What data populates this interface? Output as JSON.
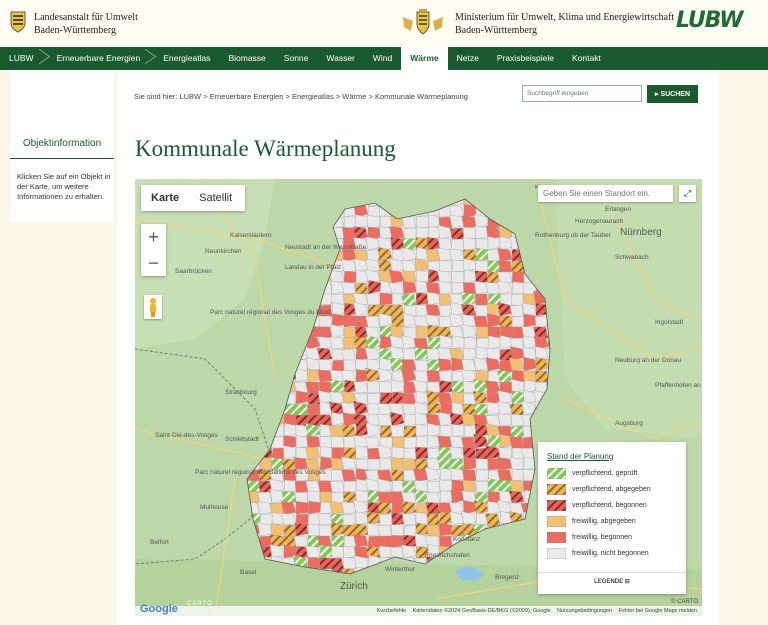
{
  "header": {
    "org_left_line1": "Landesanstalt für Umwelt",
    "org_left_line2": "Baden-Württemberg",
    "org_right_line1": "Ministerium für Umwelt, Klima und Energiewirtschaft",
    "org_right_line2": "Baden-Württemberg",
    "brand": "LUBW"
  },
  "nav": {
    "items": [
      "LUBW",
      "Erneuerbare Energien",
      "Energieatlas",
      "Biomasse",
      "Sonne",
      "Wasser",
      "Wind",
      "Wärme",
      "Netze",
      "Praxisbeispiele",
      "Kontakt"
    ],
    "active": "Wärme"
  },
  "breadcrumb": "Sie sind hier: LUBW > Erneuerbare Energien > Energieatlas > Wärme > Kommunale Wärmeplanung",
  "search": {
    "placeholder": "Suchbegriff eingeben",
    "button": "▸ SUCHEN"
  },
  "sidebar": {
    "title": "Objektinformation",
    "text": "Klicken Sie auf ein Objekt in der Karte, um weitere Informationen zu erhalten."
  },
  "page_title": "Kommunale Wärmeplanung",
  "map": {
    "tab_map": "Karte",
    "tab_satellite": "Satellit",
    "zoom_in": "+",
    "zoom_out": "−",
    "location_placeholder": "Geben Sie einen Standort ein.",
    "fullscreen_icon": "⤢",
    "place_labels": [
      "Kaiserslautern",
      "Neunkirchen",
      "Saarbrücken",
      "Neustadt an der Weinstraße",
      "Landau in der Pfalz",
      "Parc naturel régional des Vosges du Nord",
      "Strasbourg",
      "Saint-Dié-des-Vosges",
      "Schlettstadt",
      "Parc naturel régional des Ballons des Vosges",
      "Mulhouse",
      "Belfort",
      "Basel",
      "Zürich",
      "Winterthur",
      "Bregenz",
      "Friedrichshafen",
      "Erlangen",
      "Nürnberg",
      "Herzogenaurach",
      "Schwabach",
      "Rothenburg ob der Tauber",
      "Ingolstadt",
      "Neuburg an der Donau",
      "Pfaffenhofen an der Ilm",
      "Augsburg",
      "Kitzingen",
      "Konstanz"
    ],
    "legend": {
      "title": "Stand der Planung",
      "items": [
        {
          "label": "verpflichtend, geprüft",
          "color": "#7ecb4f",
          "hatched": true
        },
        {
          "label": "verpflichtend, abgegeben",
          "color": "#f0b45a",
          "hatched": true
        },
        {
          "label": "verpflichtend, begonnen",
          "color": "#e8635a",
          "hatched": true
        },
        {
          "label": "freiwillig, abgegeben",
          "color": "#f3bf72",
          "hatched": false
        },
        {
          "label": "freiwillig, begonnen",
          "color": "#ee6b5f",
          "hatched": false
        },
        {
          "label": "freiwillig, nicht begonnen",
          "color": "#e9e9e9",
          "hatched": false
        }
      ],
      "button": "LEGENDE ⊟"
    },
    "attribution": [
      "Kurzbefehle",
      "Kartendaten ©2024 GeoBasis-DE/BKG (©2009), Google",
      "Nutzungsbedingungen",
      "Fehler bei Google Maps melden"
    ],
    "google": "Google",
    "carto": "CARTO",
    "carto_copy": "© CARTO"
  }
}
